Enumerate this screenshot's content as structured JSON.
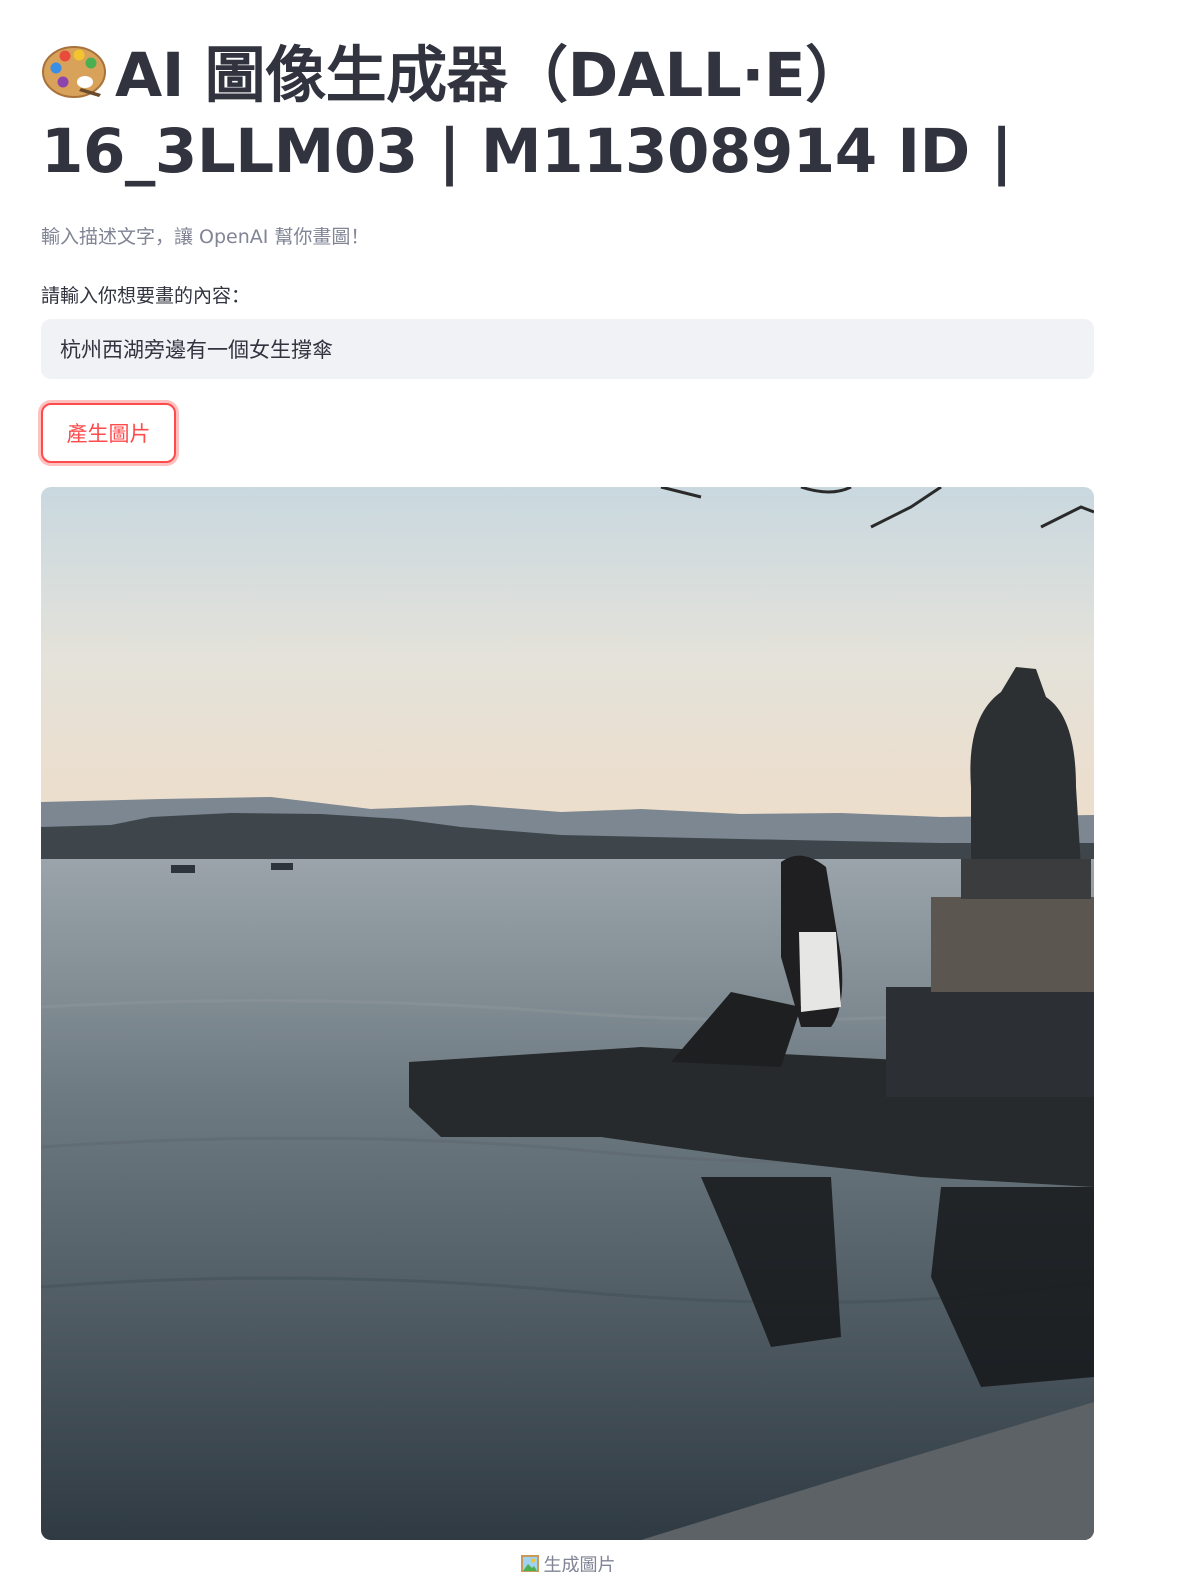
{
  "header": {
    "title_line1": "AI 圖像生成器（DALL·E）",
    "title_line2": "16_3LLM03 | M11308914 ID |",
    "title_icon": "artist-palette-icon"
  },
  "subtitle": "輸入描述文字，讓 OpenAI 幫你畫圖！",
  "prompt_input": {
    "label": "請輸入你想要畫的內容：",
    "value": "杭州西湖旁邊有一個女生撐傘"
  },
  "generate_button": {
    "label": "產生圖片",
    "color": "#ff4b4b"
  },
  "generated_image": {
    "caption": "生成圖片",
    "caption_icon": "framed-picture-icon"
  }
}
